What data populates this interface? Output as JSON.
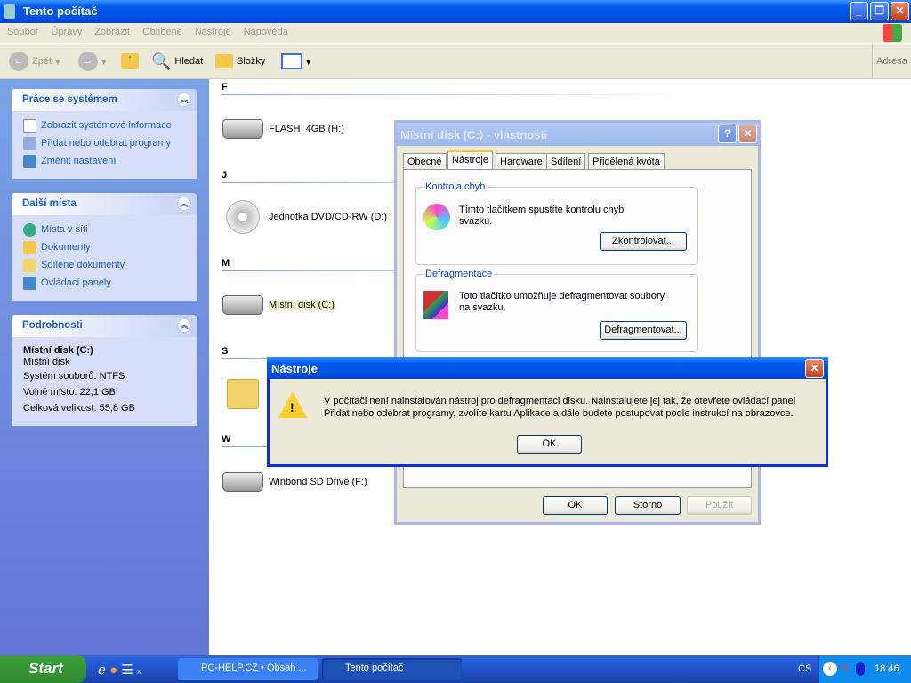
{
  "window": {
    "title": "Tento počítač"
  },
  "menu": [
    "Soubor",
    "Úpravy",
    "Zobrazit",
    "Oblíbené",
    "Nástroje",
    "Nápověda"
  ],
  "toolbar": {
    "back": "Zpět",
    "search": "Hledat",
    "folders": "Složky",
    "address": "Adresa"
  },
  "sidebar": {
    "system": {
      "title": "Práce se systémem",
      "items": [
        "Zobrazit systémové informace",
        "Přidat nebo odebrat programy",
        "Změnit nastavení"
      ]
    },
    "places": {
      "title": "Další místa",
      "items": [
        "Místa v síti",
        "Dokumenty",
        "Sdílené dokumenty",
        "Ovládací panely"
      ]
    },
    "details": {
      "title": "Podrobnosti",
      "name": "Místní disk (C:)",
      "type": "Místní disk",
      "fs": "Systém souborů: NTFS",
      "free": "Volné místo: 22,1 GB",
      "total": "Celková velikost: 55,8 GB"
    }
  },
  "groups": [
    "F",
    "J",
    "M",
    "S",
    "W"
  ],
  "drives": [
    "FLASH_4GB (H:)",
    "Jednotka DVD/CD-RW (D:)",
    "Místní disk (C:)",
    "Winbond SD Drive (F:)"
  ],
  "props": {
    "title": "Místní disk (C:) - vlastnosti",
    "tabs": [
      "Obecné",
      "Nástroje",
      "Hardware",
      "Sdílení",
      "Přidělená kvóta"
    ],
    "check": {
      "legend": "Kontrola chyb",
      "text": "Tímto tlačítkem spustíte kontrolu chyb svazku.",
      "button": "Zkontrolovat..."
    },
    "defrag": {
      "legend": "Defragmentace",
      "text": "Toto tlačítko umožňuje defragmentovat soubory na svazku.",
      "button": "Defragmentovat..."
    },
    "ok": "OK",
    "cancel": "Storno",
    "apply": "Použít"
  },
  "msg": {
    "title": "Nástroje",
    "text": "V počítači není nainstalován nástroj pro defragmentaci disku. Nainstalujete jej tak, že otevřete ovládací panel Přidat nebo odebrat programy, zvolíte kartu Aplikace a dále budete postupovat podle instrukcí na obrazovce.",
    "ok": "OK"
  },
  "taskbar": {
    "start": "Start",
    "tasks": [
      "PC-HELP.CZ • Obsah ...",
      "Tento počítač"
    ],
    "lang": "CS",
    "time": "18:46"
  }
}
